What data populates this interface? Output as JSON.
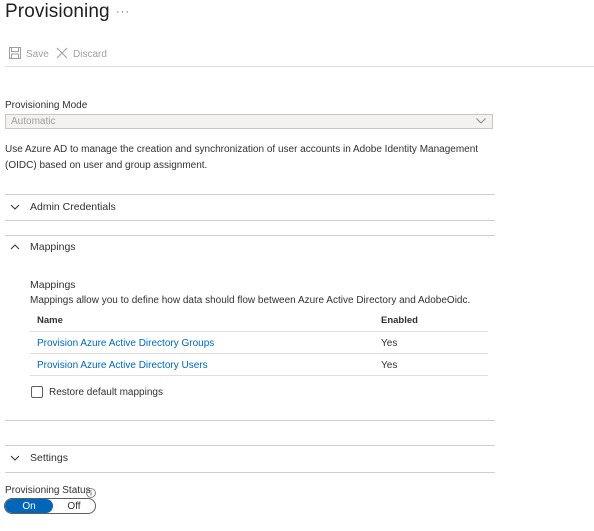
{
  "page": {
    "title": "Provisioning",
    "more_label": "···"
  },
  "toolbar": {
    "save_label": "Save",
    "discard_label": "Discard",
    "save_icon": "save-icon",
    "discard_icon": "close-icon"
  },
  "provisioning_mode": {
    "label": "Provisioning Mode",
    "value": "Automatic",
    "description": "Use Azure AD to manage the creation and synchronization of user accounts in Adobe Identity Management (OIDC) based on user and group assignment."
  },
  "admin_credentials": {
    "label": "Admin Credentials",
    "expanded": false
  },
  "mappings_section": {
    "label": "Mappings",
    "expanded": true,
    "subheading": "Mappings",
    "description": "Mappings allow you to define how data should flow between Azure Active Directory and AdobeOidc.",
    "columns": [
      "Name",
      "Enabled"
    ],
    "rows": [
      {
        "name": "Provision Azure Active Directory Groups",
        "enabled": "Yes"
      },
      {
        "name": "Provision Azure Active Directory Users",
        "enabled": "Yes"
      }
    ],
    "restore_label": "Restore default mappings",
    "restore_checked": false
  },
  "settings": {
    "label": "Settings",
    "expanded": false
  },
  "provisioning_status": {
    "label": "Provisioning Status",
    "on_label": "On",
    "off_label": "Off",
    "selected": "On"
  },
  "colors": {
    "accent": "#0067b8",
    "link": "#0067b8",
    "disabled_text": "#a19f9d"
  }
}
